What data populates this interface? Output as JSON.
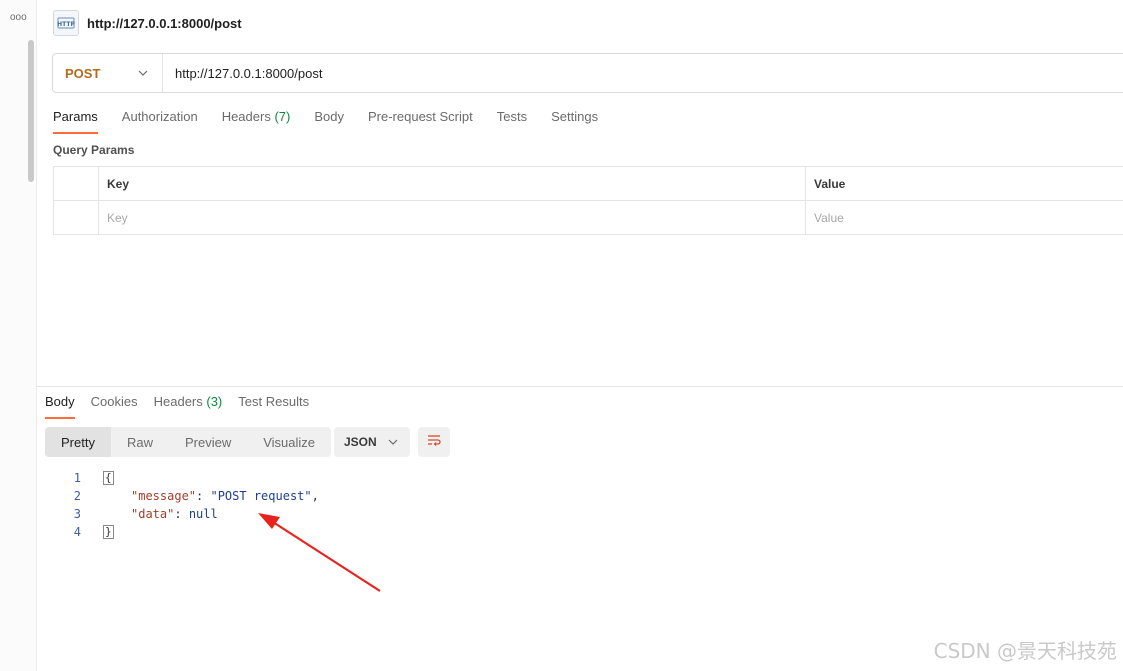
{
  "rail": {
    "more_icon": "ooo"
  },
  "request": {
    "title": "http://127.0.0.1:8000/post",
    "icon": "http-file-icon",
    "method": "POST",
    "url": "http://127.0.0.1:8000/post"
  },
  "request_tabs": {
    "params": "Params",
    "authorization": "Authorization",
    "headers": "Headers",
    "headers_count": "(7)",
    "body": "Body",
    "prerequest": "Pre-request Script",
    "tests": "Tests",
    "settings": "Settings"
  },
  "query_params": {
    "label": "Query Params",
    "header_key": "Key",
    "header_value": "Value",
    "placeholder_key": "Key",
    "placeholder_value": "Value"
  },
  "response_tabs": {
    "body": "Body",
    "cookies": "Cookies",
    "headers": "Headers",
    "headers_count": "(3)",
    "test_results": "Test Results"
  },
  "view_modes": {
    "pretty": "Pretty",
    "raw": "Raw",
    "preview": "Preview",
    "visualize": "Visualize"
  },
  "format": "JSON",
  "code": {
    "lines": [
      "1",
      "2",
      "3",
      "4"
    ],
    "open_brace": "{",
    "close_brace": "}",
    "key_message": "\"message\"",
    "val_message": "\"POST request\"",
    "key_data": "\"data\"",
    "val_data": "null",
    "colon": ": ",
    "comma": ","
  },
  "watermark": "CSDN @景天科技苑",
  "colors": {
    "accent": "#ff6c37",
    "method": "#b36a1c",
    "count": "#0b8a3c",
    "arrow": "#e8231c"
  }
}
